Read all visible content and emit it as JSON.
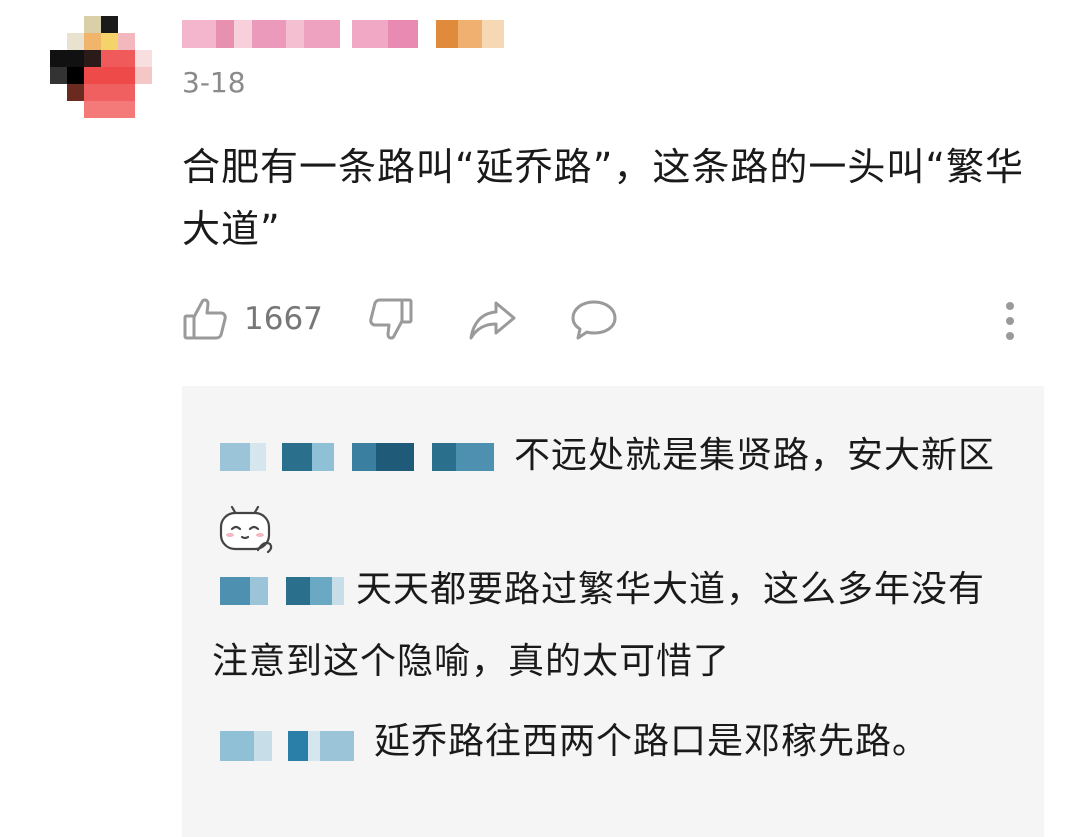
{
  "comment": {
    "avatar_icon": "pixelated-avatar-icon",
    "username_obscured": true,
    "date": "3-18",
    "text": "合肥有一条路叫“延乔路”，这条路的一头叫“繁华大道”",
    "likes": "1667"
  },
  "actions": {
    "like_icon": "thumbs-up-icon",
    "dislike_icon": "thumbs-down-icon",
    "share_icon": "share-arrow-icon",
    "reply_icon": "speech-bubble-icon",
    "more_icon": "more-vertical-icon"
  },
  "replies": [
    {
      "text": "不远处就是集贤路，安大新区",
      "emoji": "shy-face-emoji-icon"
    },
    {
      "text": "天天都要路过繁华大道，这么多年没有注意到这个隐喻，真的太可惜了"
    },
    {
      "text": "延乔路往西两个路口是邓稼先路。"
    }
  ],
  "colors": {
    "background": "#ffffff",
    "replies_background": "#f5f5f5",
    "icon": "#9a9a9a",
    "meta_text": "#8a8a8a"
  }
}
